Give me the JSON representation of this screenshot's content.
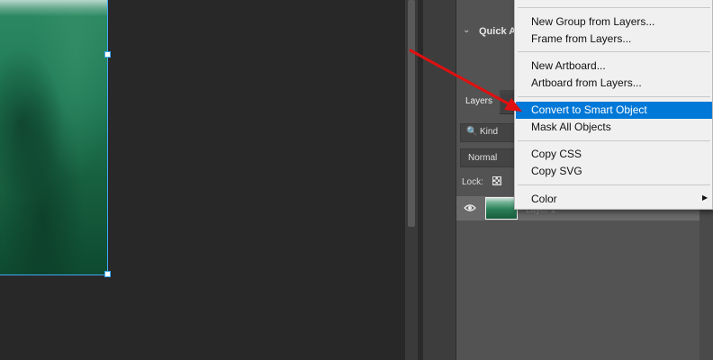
{
  "panels": {
    "quick_actions_title": "Quick A",
    "chevron": "⌄",
    "layers_tab": "Layers",
    "kind_icon": "🔍",
    "kind_label": "Kind",
    "blend_mode": "Normal",
    "lock_label": "Lock:",
    "layer_name": "Layer 1"
  },
  "context_menu": {
    "items": [
      {
        "label": "New Group from Layers..."
      },
      {
        "label": "Frame from Layers..."
      },
      {
        "label": "New Artboard..."
      },
      {
        "label": "Artboard from Layers..."
      },
      {
        "label": "Convert to Smart Object",
        "highlighted": true
      },
      {
        "label": "Mask All Objects"
      },
      {
        "label": "Copy CSS"
      },
      {
        "label": "Copy SVG"
      },
      {
        "label": "Color",
        "has_submenu": true
      }
    ],
    "submenu_arrow": "▶"
  },
  "colors": {
    "highlight": "#0078d7",
    "annotation_arrow": "#e01010",
    "selection_border": "#3fa9f5"
  }
}
